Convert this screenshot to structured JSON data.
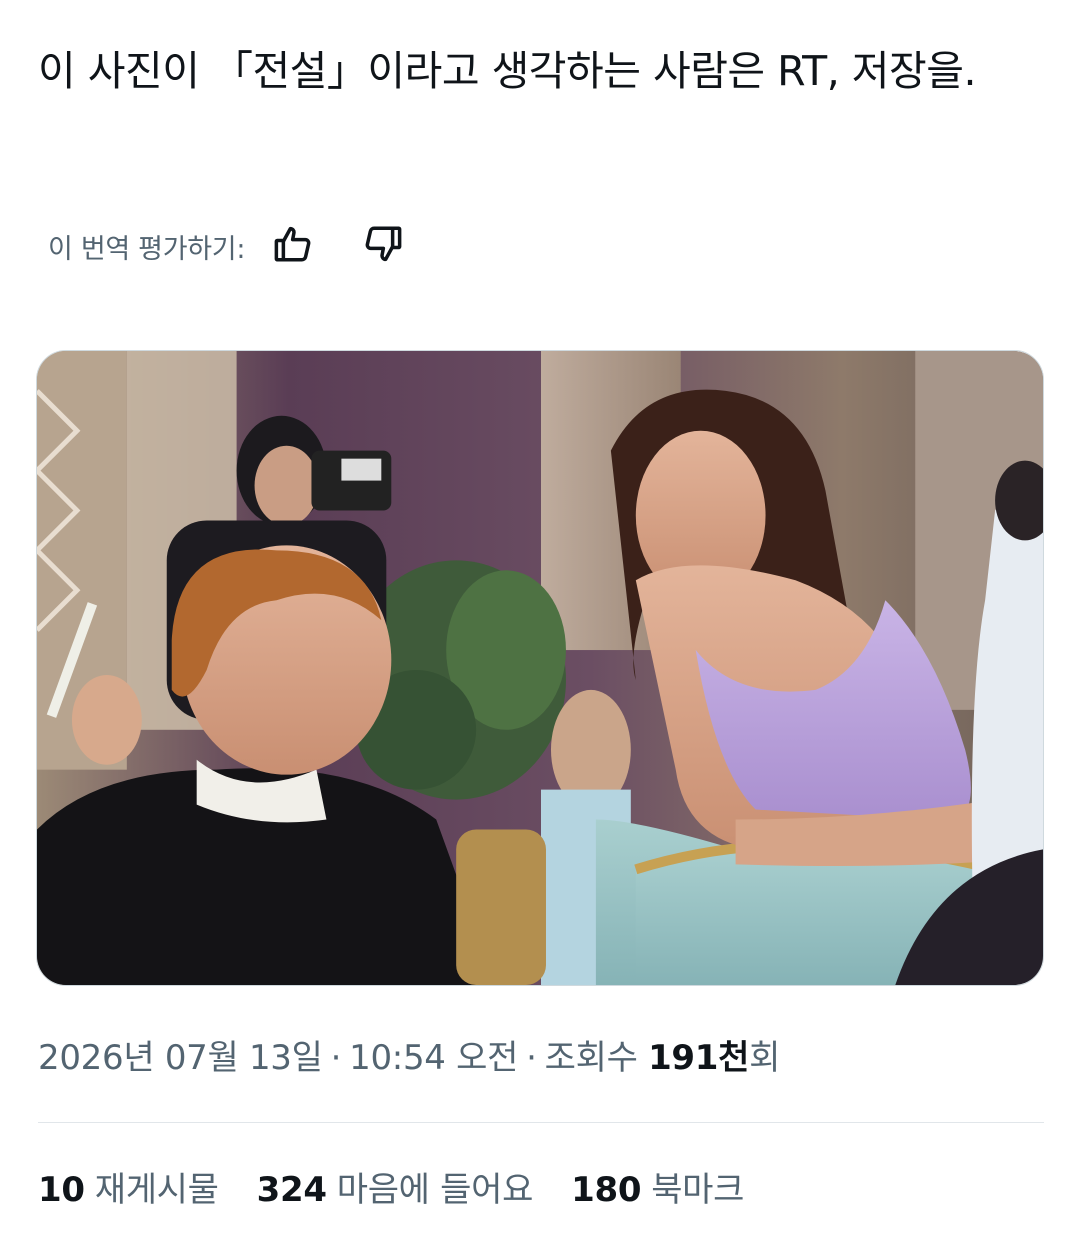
{
  "tweet": {
    "text": "이 사진이 「전설」이라고 생각하는 사람은 RT, 저장을."
  },
  "translation": {
    "label": "이 번역 평가하기:"
  },
  "meta": {
    "date": "2026년 07월 13일",
    "separator": "·",
    "time": "10:54 오전",
    "views_label": "조회수",
    "views_count": "191천",
    "views_suffix": "회"
  },
  "stats": [
    {
      "count": "10",
      "label": "재게시물"
    },
    {
      "count": "324",
      "label": "마음에 들어요"
    },
    {
      "count": "180",
      "label": "북마크"
    }
  ],
  "icons": {
    "rate_good": "thumbs-up-icon",
    "rate_bad": "thumbs-down-icon"
  },
  "colors": {
    "text_primary": "#0f1419",
    "text_secondary": "#536471",
    "divider": "#e1e6ea"
  }
}
